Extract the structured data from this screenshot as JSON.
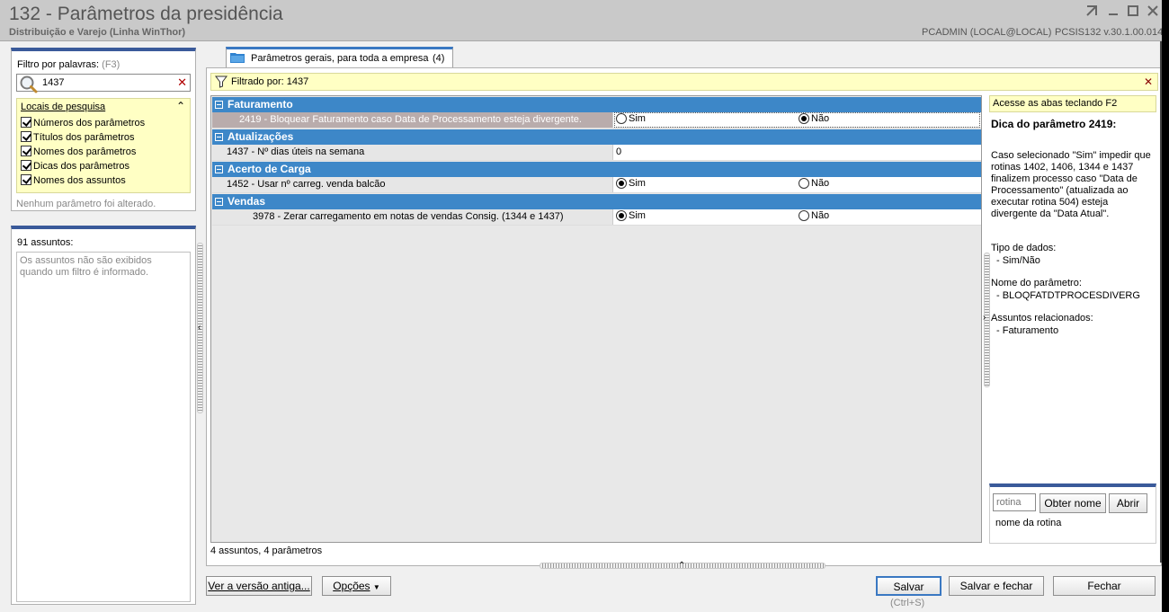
{
  "window": {
    "title": "132 - Parâmetros da presidência",
    "subtitle": "Distribuição e Varejo (Linha WinThor)",
    "user": "PCADMIN (LOCAL@LOCAL)",
    "version": "PCSIS132  v.30.1.00.014"
  },
  "filter": {
    "label": "Filtro por palavras:",
    "shortcut": "(F3)",
    "search_value": "1437",
    "locais_title": "Locais de pesquisa",
    "options": [
      "Números dos parâmetros",
      "Títulos dos parâmetros",
      "Nomes dos parâmetros",
      "Dicas dos parâmetros",
      "Nomes dos assuntos"
    ],
    "no_change": "Nenhum parâmetro foi alterado."
  },
  "subjects": {
    "count_label": "91 assuntos:",
    "note": "Os assuntos não são exibidos quando um filtro é informado."
  },
  "tab": {
    "label": "Parâmetros gerais, para toda a empresa",
    "count": "(4)"
  },
  "filter_banner": {
    "text": "Filtrado por: 1437"
  },
  "grid": {
    "groups": [
      {
        "name": "Faturamento",
        "row": {
          "label": "2419 - Bloquear Faturamento caso Data de Processamento esteja divergente.",
          "type": "radio",
          "yes": "Sim",
          "no": "Não",
          "selected": "no"
        }
      },
      {
        "name": "Atualizações",
        "row": {
          "label": "1437 - Nº dias úteis na semana",
          "type": "value",
          "value": "0"
        }
      },
      {
        "name": "Acerto de Carga",
        "row": {
          "label": "1452 - Usar nº carreg. venda balcão",
          "type": "radio",
          "yes": "Sim",
          "no": "Não",
          "selected": "yes"
        }
      },
      {
        "name": "Vendas",
        "row": {
          "label": "3978 - Zerar carregamento em notas de vendas Consig. (1344 e 1437)",
          "type": "radio",
          "yes": "Sim",
          "no": "Não",
          "selected": "yes"
        }
      }
    ],
    "status": "4 assuntos, 4 parâmetros"
  },
  "help": {
    "banner": "Acesse as abas teclando F2",
    "title": "Dica do parâmetro 2419:",
    "description": "Caso selecionado \"Sim\" impedir que rotinas 1402, 1406, 1344 e 1437 finalizem processo caso  \"Data de Processamento\" (atualizada ao executar rotina 504) esteja divergente da \"Data Atual\".",
    "data_type_label": "Tipo de dados:",
    "data_type_value": "- Sim/Não",
    "param_name_label": "Nome do parâmetro:",
    "param_name_value": "- BLOQFATDTPROCESDIVERG",
    "related_label": "Assuntos relacionados:",
    "related_value": "- Faturamento"
  },
  "rotina": {
    "placeholder": "rotina",
    "get_name": "Obter nome",
    "open": "Abrir",
    "caption": "nome da rotina"
  },
  "buttons": {
    "old_version": "Ver a versão antiga...",
    "options": "Opções",
    "save": "Salvar",
    "save_shortcut": "(Ctrl+S)",
    "save_close": "Salvar e fechar",
    "close": "Fechar"
  }
}
